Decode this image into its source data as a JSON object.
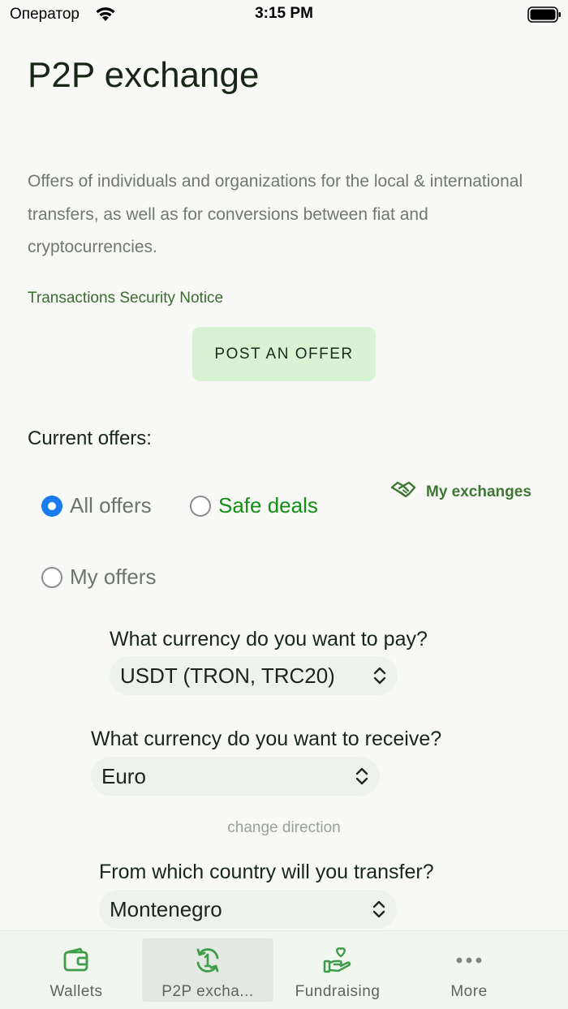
{
  "status_bar": {
    "carrier": "Оператор",
    "time": "3:15 PM"
  },
  "page": {
    "title": "P2P exchange",
    "intro": "Offers of individuals and organizations for the local & international transfers, as well as for conversions between fiat and cryptocurrencies.",
    "notice_link": "Transactions Security Notice",
    "post_button": "POST AN OFFER",
    "current_offers_heading": "Current offers:"
  },
  "filters": {
    "all_offers": "All offers",
    "safe_deals": "Safe deals",
    "my_offers": "My offers",
    "selected": "All offers",
    "my_exchanges": "My exchanges"
  },
  "pay": {
    "label": "What currency do you want to pay?",
    "value": "USDT (TRON, TRC20)"
  },
  "receive": {
    "label": "What currency do you want to receive?",
    "value": "Euro"
  },
  "change_direction": "change direction",
  "country": {
    "label": "From which country will you transfer?",
    "value": "Montenegro"
  },
  "tabs": [
    {
      "label": "Wallets",
      "icon": "wallet-icon"
    },
    {
      "label": "P2P excha...",
      "icon": "exchange-icon",
      "active": true
    },
    {
      "label": "Fundraising",
      "icon": "heart-hand-icon"
    },
    {
      "label": "More",
      "icon": "more-icon"
    }
  ],
  "colors": {
    "accent_green": "#3e7634",
    "safe_green": "#148f14",
    "button_bg": "#d7f3d4",
    "radio_blue": "#1a7cf0"
  }
}
